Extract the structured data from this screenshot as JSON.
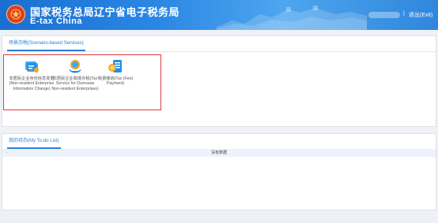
{
  "header": {
    "title_zh": "国家税务总局辽宁省电子税务局",
    "title_en": "E-tax China",
    "separator": "|",
    "logout_label": "退出(Exit)"
  },
  "scenario_panel": {
    "tab_label": "场景办税(Scenario-based Services)",
    "services": [
      {
        "label": "非居民企业身份信息变更(Non-resident Enterprise Information Change)",
        "icon": "id-card-icon"
      },
      {
        "label": "非居民企业跨境办税(Tax Service for Overseas Non-resident Enterprises)",
        "icon": "cross-border-icon"
      },
      {
        "label": "税费缴纳(Tax (Fee) Payment)",
        "icon": "payment-icon"
      }
    ]
  },
  "todo_panel": {
    "tab_label": "我的待办(My To-do List)",
    "empty_text": "没有数据",
    "column_marker": "-"
  },
  "colors": {
    "header_blue": "#2a86e4",
    "accent_blue": "#2b7fd9",
    "highlight_red": "#e0383e"
  }
}
